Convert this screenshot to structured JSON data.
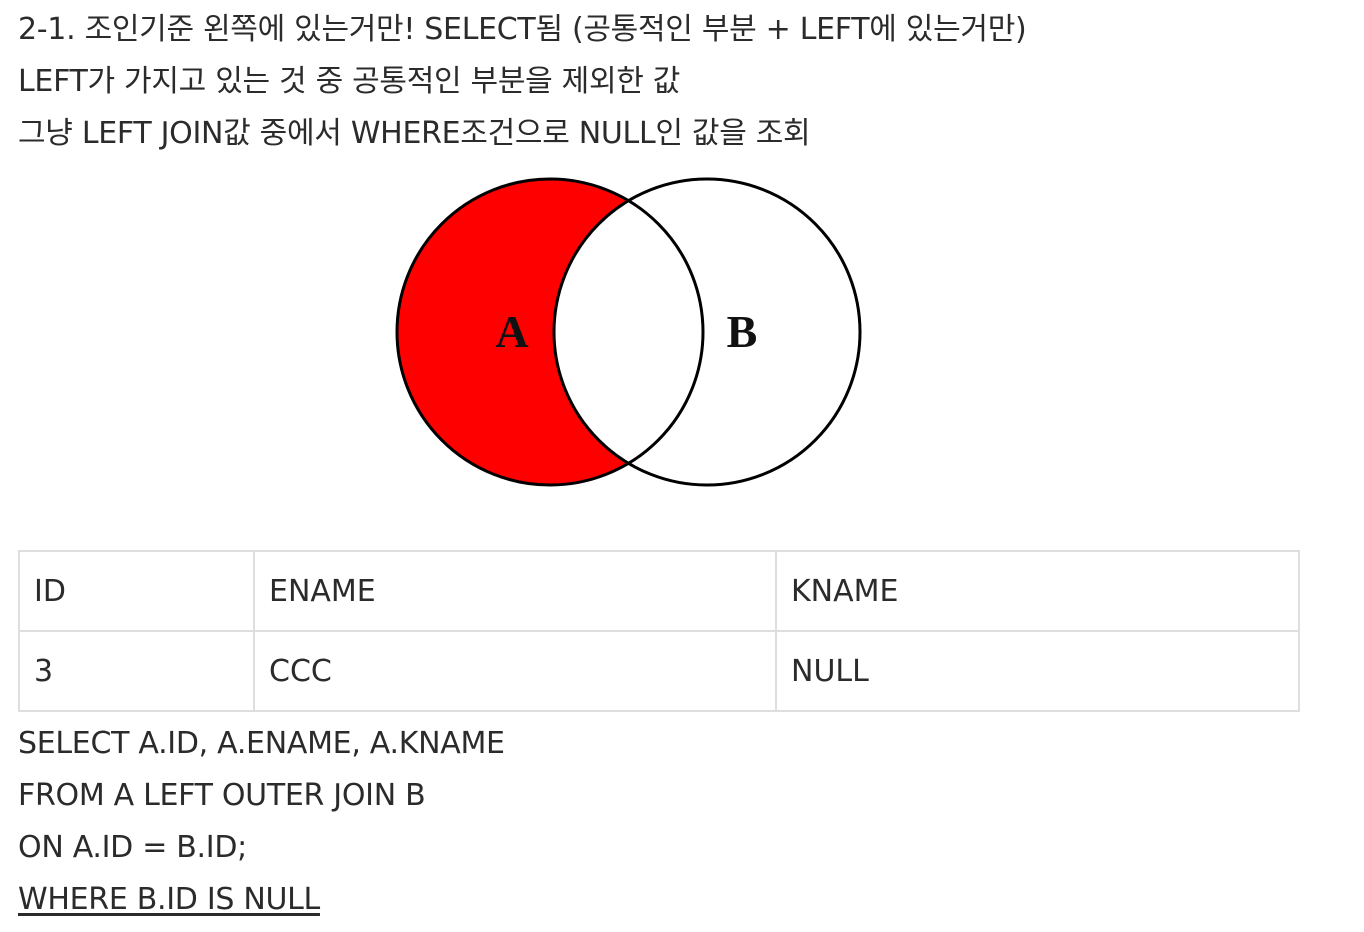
{
  "text": {
    "line1": "2-1. 조인기준 왼쪽에 있는거만! SELECT됨 (공통적인 부분 + LEFT에 있는거만)",
    "line2": "LEFT가 가지고 있는 것 중 공통적인 부분을 제외한 값",
    "line3": "그냥 LEFT JOIN값 중에서 WHERE조건으로 NULL인 값을 조회"
  },
  "venn": {
    "label_a": "A",
    "label_b": "B",
    "fill_color": "#ff0000",
    "stroke_color": "#000000"
  },
  "table": {
    "headers": [
      "ID",
      "ENAME",
      "KNAME"
    ],
    "rows": [
      [
        "3",
        "CCC",
        "NULL"
      ]
    ]
  },
  "sql": {
    "line1": "SELECT A.ID, A.ENAME, A.KNAME",
    "line2": "FROM A LEFT OUTER JOIN B",
    "line3": "ON A.ID = B.ID;",
    "line4": "WHERE B.ID IS NULL"
  }
}
